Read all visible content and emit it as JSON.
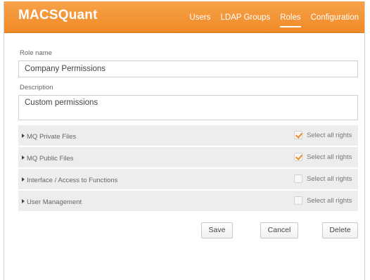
{
  "header": {
    "app_title": "MACSQuant",
    "nav": [
      {
        "label": "Users",
        "active": false
      },
      {
        "label": "LDAP Groups",
        "active": false
      },
      {
        "label": "Roles",
        "active": true
      },
      {
        "label": "Configuration",
        "active": false
      }
    ]
  },
  "form": {
    "role_name_label": "Role name",
    "role_name_value": "Company Permissions",
    "description_label": "Description",
    "description_value": "Custom permissions"
  },
  "rights": [
    {
      "title": "MQ Private Files",
      "select_all_label": "Select all rights",
      "checked": true
    },
    {
      "title": "MQ Public Files",
      "select_all_label": "Select all rights",
      "checked": true
    },
    {
      "title": "Interface / Access to Functions",
      "select_all_label": "Select all rights",
      "checked": false
    },
    {
      "title": "User Management",
      "select_all_label": "Select all rights",
      "checked": false
    }
  ],
  "buttons": {
    "save": "Save",
    "cancel": "Cancel",
    "delete": "Delete"
  },
  "colors": {
    "accent": "#f08a26"
  }
}
